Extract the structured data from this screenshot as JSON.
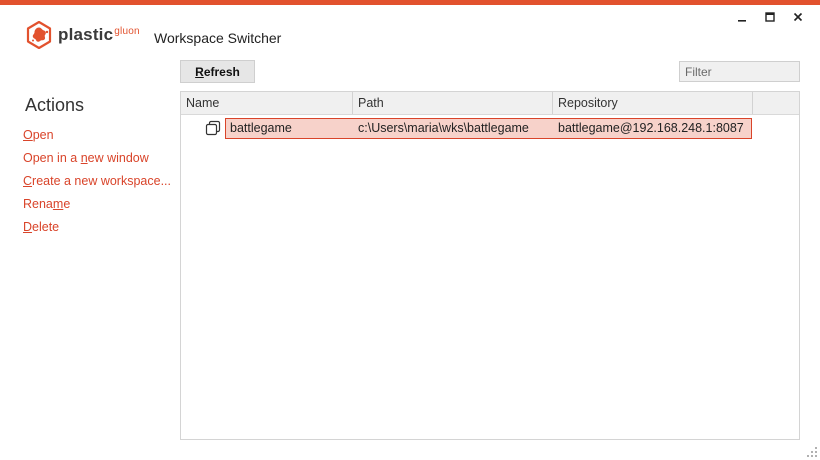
{
  "app": {
    "logo_text": "plastic",
    "logo_sup": "gluon",
    "window_title": "Workspace Switcher",
    "accent_color": "#e2522e"
  },
  "window_controls": {
    "minimize_icon": "minimize-icon",
    "maximize_icon": "maximize-icon",
    "close_icon": "close-icon"
  },
  "sidebar": {
    "heading": "Actions",
    "items": [
      {
        "pre": "",
        "u": "O",
        "post": "pen"
      },
      {
        "pre": "Open in a ",
        "u": "n",
        "post": "ew window"
      },
      {
        "pre": "",
        "u": "C",
        "post": "reate a new workspace..."
      },
      {
        "pre": "Rena",
        "u": "m",
        "post": "e"
      },
      {
        "pre": "",
        "u": "D",
        "post": "elete"
      }
    ]
  },
  "toolbar": {
    "refresh": {
      "u": "R",
      "post": "efresh"
    },
    "filter_placeholder": "Filter"
  },
  "table": {
    "columns": [
      "Name",
      "Path",
      "Repository"
    ],
    "rows": [
      {
        "name": "battlegame",
        "path": "c:\\Users\\maria\\wks\\battlegame",
        "repository": "battlegame@192.168.248.1:8087",
        "selected": true,
        "icon": "workspace-icon"
      }
    ]
  }
}
